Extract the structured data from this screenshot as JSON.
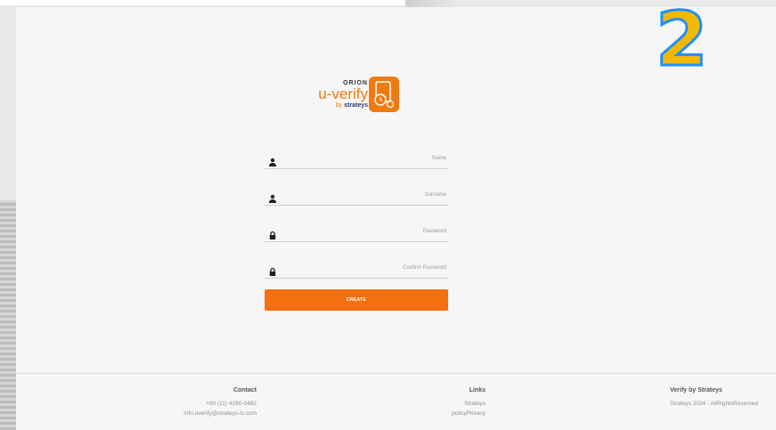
{
  "overlay": {
    "number": "2"
  },
  "logo": {
    "brand": "ORION",
    "product": "u-verify",
    "by_prefix": "by",
    "by_company": "strateys"
  },
  "form": {
    "fields": [
      {
        "label": "Name",
        "icon": "person-icon"
      },
      {
        "label": "Surname",
        "icon": "person-icon"
      },
      {
        "label": "Password",
        "icon": "lock-icon"
      },
      {
        "label": "Confirm Password",
        "icon": "lock-icon"
      }
    ],
    "submit_label": "CREATE"
  },
  "footer": {
    "contact": {
      "heading": "Contact",
      "phone": "+90 (11) 4290-0482",
      "email": "info.uverify@strateys-ls.com"
    },
    "links": {
      "heading": "Links",
      "items": [
        "Strateys",
        "policyPrivacy"
      ]
    },
    "brand": {
      "heading": "Verify by Strateys",
      "copyright": "Strateys 2024 - AllRightsReserved"
    }
  },
  "colors": {
    "accent": "#f36f0f",
    "overlay_fill": "#f5b800",
    "overlay_stroke": "#1e90ff"
  }
}
